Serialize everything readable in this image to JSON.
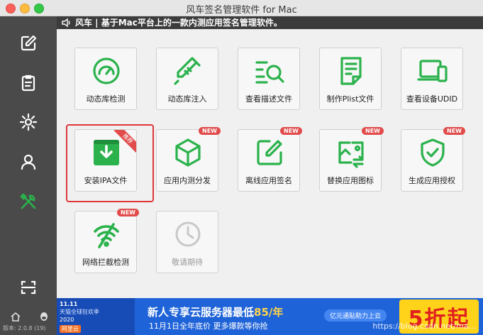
{
  "window": {
    "title": "风车签名管理软件 for Mac"
  },
  "notice": {
    "text": "风车 | 基于Mac平台上的一款内测应用签名管理软件。"
  },
  "sidebar": {
    "items": [
      {
        "name": "edit-icon"
      },
      {
        "name": "clipboard-icon"
      },
      {
        "name": "gear-icon"
      },
      {
        "name": "user-icon"
      },
      {
        "name": "tools-icon",
        "active": true
      },
      {
        "name": "scan-icon"
      }
    ],
    "version": "版本: 2.0.8 (19)"
  },
  "tools": {
    "items": [
      {
        "label": "动态库检测",
        "icon": "gauge-icon"
      },
      {
        "label": "动态库注入",
        "icon": "syringe-icon"
      },
      {
        "label": "查看描述文件",
        "icon": "search-list-icon"
      },
      {
        "label": "制作Plist文件",
        "icon": "document-icon"
      },
      {
        "label": "查看设备UDID",
        "icon": "device-icon"
      },
      {
        "label": "安装IPA文件",
        "icon": "install-box-icon",
        "tag": "推荐"
      },
      {
        "label": "应用内测分发",
        "icon": "cube-icon",
        "tag": "NEW"
      },
      {
        "label": "离线应用签名",
        "icon": "pen-square-icon",
        "tag": "NEW"
      },
      {
        "label": "替换应用图标",
        "icon": "image-swap-icon",
        "tag": "NEW"
      },
      {
        "label": "生成应用授权",
        "icon": "shield-check-icon",
        "tag": "NEW"
      },
      {
        "label": "网络拦截检测",
        "icon": "wifi-block-icon",
        "tag": "NEW"
      },
      {
        "label": "敬请期待",
        "icon": "clock-icon",
        "disabled": true
      }
    ]
  },
  "banner": {
    "left_line1": "11.11",
    "left_line2": "天猫全球狂欢季",
    "left_line3": "2020",
    "left_line4": "阿里云",
    "title_prefix": "新人专享云服务器最低",
    "title_price": "85/年",
    "subtitle": "11月1日全年底价 更多爆款等你抢",
    "pill": "亿元通贴助力上云",
    "big": "5折起",
    "watermark": "https://blog.csdn.net/ma..."
  },
  "colors": {
    "accent_green": "#2bb24c",
    "badge_red": "#e14b4b",
    "sidebar_bg": "#4a4a4a"
  }
}
